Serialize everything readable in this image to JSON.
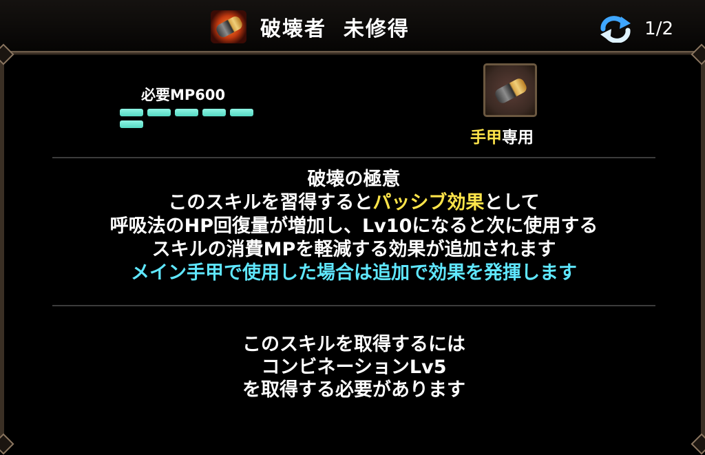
{
  "header": {
    "title": "破壊者  未修得",
    "page": "1/2"
  },
  "skill": {
    "required_mp_label": "必要MP600",
    "mp_cost_fraction": 1.0,
    "weapon_label": {
      "part1": "手甲",
      "part2": "専用"
    }
  },
  "description": {
    "name": "破壊の極意",
    "line1_a": "このスキルを習得すると",
    "line1_b": "パッシブ効果",
    "line1_c": "として",
    "line2": "呼吸法のHP回復量が増加し、Lv10になると次に使用する",
    "line3": "スキルの消費MPを軽減する効果が追加されます",
    "line4": "メイン手甲で使用した場合は追加で効果を発揮します"
  },
  "requirement": {
    "line1": "このスキルを取得するには",
    "line2": "コンビネーションLv5",
    "line3": "を取得する必要があります"
  },
  "colors": {
    "highlight_yellow": "#ffe54a",
    "highlight_cyan": "#5fe7ff",
    "mp_bar": "#6ee8d3"
  },
  "icons": [
    "gauntlet-icon",
    "refresh-icon",
    "weapon-gauntlet-icon"
  ]
}
